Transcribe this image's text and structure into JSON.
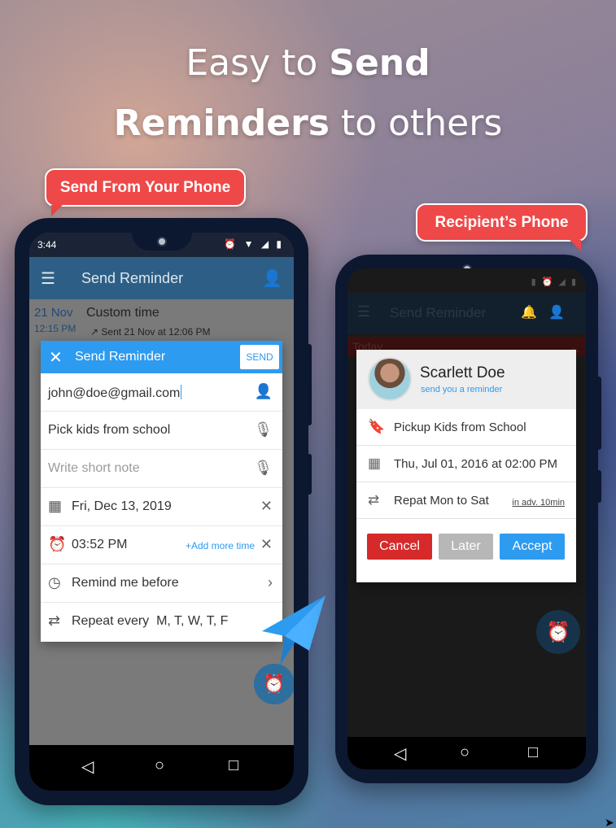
{
  "headline": {
    "line1_regular": "Easy to ",
    "line1_bold": "Send",
    "line2_bold": "Reminders",
    "line2_regular": " to others"
  },
  "bubbles": {
    "left": "Send From Your Phone",
    "right": "Recipient’s Phone"
  },
  "left_phone": {
    "status_time": "3:44",
    "status_icons": "⏰ ▼ ◢ ▮",
    "appbar_title": "Send Reminder",
    "background_item": {
      "date": "21 Nov",
      "time": "12:15 PM",
      "title": "Custom time",
      "sent": "↗ Sent 21 Nov at 12:06 PM"
    },
    "dialog": {
      "title": "Send Reminder",
      "send_label": "SEND",
      "email_value": "john@doe@gmail.com",
      "task_value": "Pick kids from school",
      "note_placeholder": "Write short note",
      "date_value": "Fri, Dec 13, 2019",
      "time_value": "03:52 PM",
      "add_more_time": "+Add more time",
      "remind_before": "Remind me before",
      "repeat_label": "Repeat every",
      "repeat_days": "M, T, W, T, F"
    }
  },
  "right_phone": {
    "appbar_title": "Send Reminder",
    "section_label": "Today",
    "dialog": {
      "sender_name": "Scarlett Doe",
      "sender_subtitle": "send you a reminder",
      "task": "Pickup Kids from School",
      "datetime": "Thu, Jul 01, 2016 at 02:00 PM",
      "repeat": "Repat Mon to Sat",
      "advance": "in adv. 10min",
      "cancel_label": "Cancel",
      "later_label": "Later",
      "accept_label": "Accept"
    }
  },
  "colors": {
    "accent_blue": "#2d9bf0",
    "bubble_red": "#ef4848",
    "cancel_red": "#d62a2a",
    "later_gray": "#b7b7b7"
  },
  "icons": [
    "menu-icon",
    "user-icon",
    "close-icon",
    "add-contact-icon",
    "mic-icon",
    "calendar-icon",
    "alarm-icon",
    "remind-before-icon",
    "repeat-icon",
    "chevron-right-icon",
    "bookmark-icon",
    "bell-icon",
    "paper-plane-icon",
    "back-icon",
    "home-icon",
    "recents-icon"
  ]
}
